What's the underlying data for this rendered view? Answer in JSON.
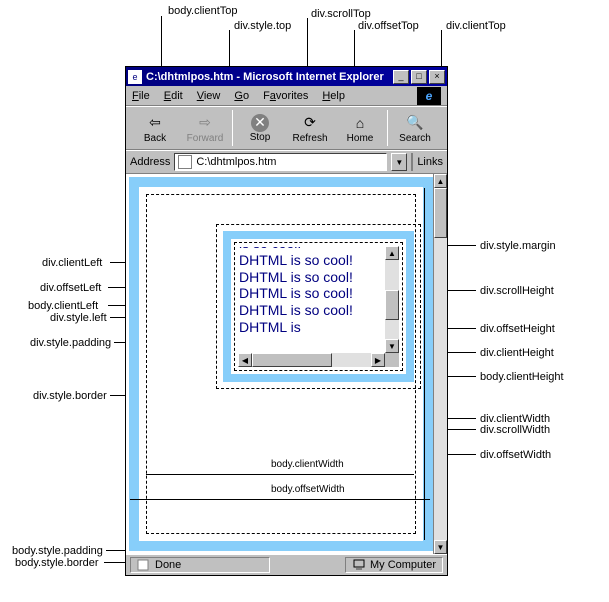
{
  "annotations": {
    "top": {
      "body_clientTop": "body.clientTop",
      "div_style_top": "div.style.top",
      "div_scrollTop": "div.scrollTop",
      "div_offsetTop": "div.offsetTop",
      "div_clientTop": "div.clientTop"
    },
    "left": {
      "div_clientLeft": "div.clientLeft",
      "div_offsetLeft": "div.offsetLeft",
      "body_clientLeft": "body.clientLeft",
      "div_style_left": "div.style.left",
      "div_style_padding": "div.style.padding",
      "div_style_border": "div.style.border",
      "body_style_padding": "body.style.padding",
      "body_style_border": "body.style.border"
    },
    "right": {
      "div_style_margin": "div.style.margin",
      "div_scrollHeight": "div.scrollHeight",
      "div_offsetHeight": "div.offsetHeight",
      "div_clientHeight": "div.clientHeight",
      "body_clientHeight": "body.clientHeight",
      "div_clientWidth": "div.clientWidth",
      "div_scrollWidth": "div.scrollWidth",
      "div_offsetWidth": "div.offsetWidth"
    },
    "inside": {
      "body_clientWidth": "body.clientWidth",
      "body_offsetWidth": "body.offsetWidth"
    }
  },
  "window": {
    "title": "C:\\dhtmlpos.htm - Microsoft Internet Explorer",
    "minimize": "_",
    "maximize": "□",
    "close": "×"
  },
  "menu": {
    "file": "File",
    "edit": "Edit",
    "view": "View",
    "go": "Go",
    "favorites": "Favorites",
    "help": "Help"
  },
  "toolbar": {
    "back": "Back",
    "forward": "Forward",
    "stop": "Stop",
    "refresh": "Refresh",
    "home": "Home",
    "search": "Search"
  },
  "address": {
    "label": "Address",
    "value": "C:\\dhtmlpos.htm",
    "links": "Links"
  },
  "div_text": "is so cool!\nDHTML is so cool! DHTML is so cool! DHTML is so cool! DHTML is so cool! DHTML is",
  "status": {
    "done": "Done",
    "zone": "My Computer"
  },
  "colors": {
    "border_blue": "#87cefa",
    "titlebar": "#000080",
    "text_navy": "#000080"
  }
}
